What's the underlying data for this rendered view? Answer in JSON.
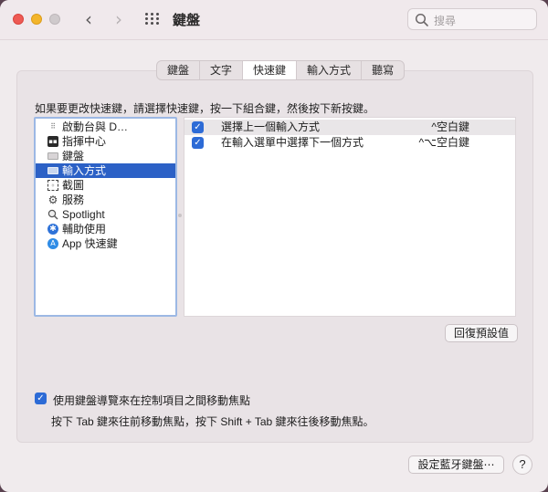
{
  "window": {
    "title": "鍵盤",
    "search_placeholder": "搜尋"
  },
  "tabs": [
    {
      "label": "鍵盤",
      "active": false
    },
    {
      "label": "文字",
      "active": false
    },
    {
      "label": "快速鍵",
      "active": true
    },
    {
      "label": "輸入方式",
      "active": false
    },
    {
      "label": "聽寫",
      "active": false
    }
  ],
  "instruction": "如果要更改快速鍵，請選擇快速鍵，按一下組合鍵，然後按下新按鍵。",
  "categories": [
    {
      "label": "啟動台與 D…",
      "icon": "launchpad-icon",
      "selected": false
    },
    {
      "label": "指揮中心",
      "icon": "mission-control-icon",
      "selected": false
    },
    {
      "label": "鍵盤",
      "icon": "keyboard-icon",
      "selected": false
    },
    {
      "label": "輸入方式",
      "icon": "input-sources-icon",
      "selected": true
    },
    {
      "label": "截圖",
      "icon": "screenshot-icon",
      "selected": false
    },
    {
      "label": "服務",
      "icon": "services-gear-icon",
      "selected": false
    },
    {
      "label": "Spotlight",
      "icon": "spotlight-icon",
      "selected": false
    },
    {
      "label": "輔助使用",
      "icon": "accessibility-icon",
      "selected": false
    },
    {
      "label": "App 快速鍵",
      "icon": "app-store-icon",
      "selected": false
    }
  ],
  "shortcuts": [
    {
      "label": "選擇上一個輸入方式",
      "keys": "^空白鍵",
      "checked": true
    },
    {
      "label": "在輸入選單中選擇下一個方式",
      "keys": "^⌥空白鍵",
      "checked": true
    }
  ],
  "buttons": {
    "restore_defaults": "回復預設值",
    "bluetooth_keyboard": "設定藍牙鍵盤⋯",
    "help": "?"
  },
  "keyboard_navigation": {
    "checked": true,
    "label": "使用鍵盤導覽來在控制項目之間移動焦點",
    "hint": "按下 Tab 鍵來往前移動焦點，按下 Shift + Tab 鍵來往後移動焦點。"
  },
  "colors": {
    "selection": "#2c61c6",
    "checkbox": "#2d6bd6",
    "close": "#ee5a54",
    "minimize": "#f3b52b"
  }
}
